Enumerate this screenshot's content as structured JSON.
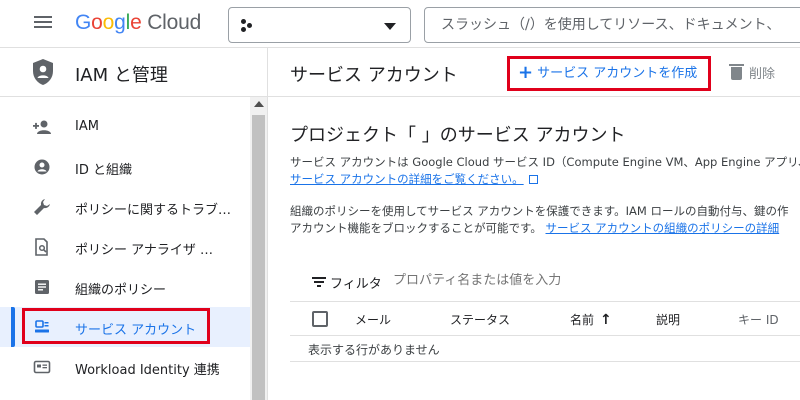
{
  "header": {
    "menu_icon": "hamburger-icon",
    "logo": {
      "parts": [
        "G",
        "o",
        "o",
        "g",
        "l",
        "e"
      ],
      "product": "Cloud"
    },
    "project_selector": {
      "icon": "project-dots-icon",
      "value": ""
    },
    "search": {
      "placeholder": "スラッシュ（/）を使用してリソース、ドキュメント、"
    }
  },
  "sidebar": {
    "title": "IAM と管理",
    "title_icon": "shield-icon",
    "items": [
      {
        "label": "IAM",
        "icon": "person-add-icon"
      },
      {
        "label": "ID と組織",
        "icon": "account-circle-icon"
      },
      {
        "label": "ポリシーに関するトラブ…",
        "icon": "wrench-icon"
      },
      {
        "label": "ポリシー アナライザ …",
        "icon": "document-search-icon"
      },
      {
        "label": "組織のポリシー",
        "icon": "article-icon"
      },
      {
        "label": "サービス アカウント",
        "icon": "service-account-icon",
        "active": true
      },
      {
        "label": "Workload Identity 連携",
        "icon": "id-card-icon"
      }
    ]
  },
  "main": {
    "title": "サービス アカウント",
    "create_label": "サービス アカウントを作成",
    "delete_label": "削除",
    "section_title": "プロジェクト「                    」のサービス アカウント",
    "desc1": "サービス アカウントは Google Cloud サービス ID（Compute Engine VM、App Engine アプリ、Co",
    "desc1_link": "サービス アカウントの詳細をご覧ください。",
    "desc2": "組織のポリシーを使用してサービス アカウントを保護できます。IAM ロールの自動付与、鍵の作",
    "desc3": "アカウント機能をブロックすることが可能です。",
    "desc3_link": "サービス アカウントの組織のポリシーの詳細",
    "filter_label": "フィルタ",
    "filter_placeholder": "プロパティ名または値を入力",
    "columns": [
      "メール",
      "ステータス",
      "名前",
      "説明",
      "キー ID"
    ],
    "sort_indicator": "↑",
    "empty_text": "表示する行がありません"
  },
  "colors": {
    "accent": "#1a73e8",
    "highlight": "#e0001b",
    "active_bg": "#e8f0fe"
  }
}
